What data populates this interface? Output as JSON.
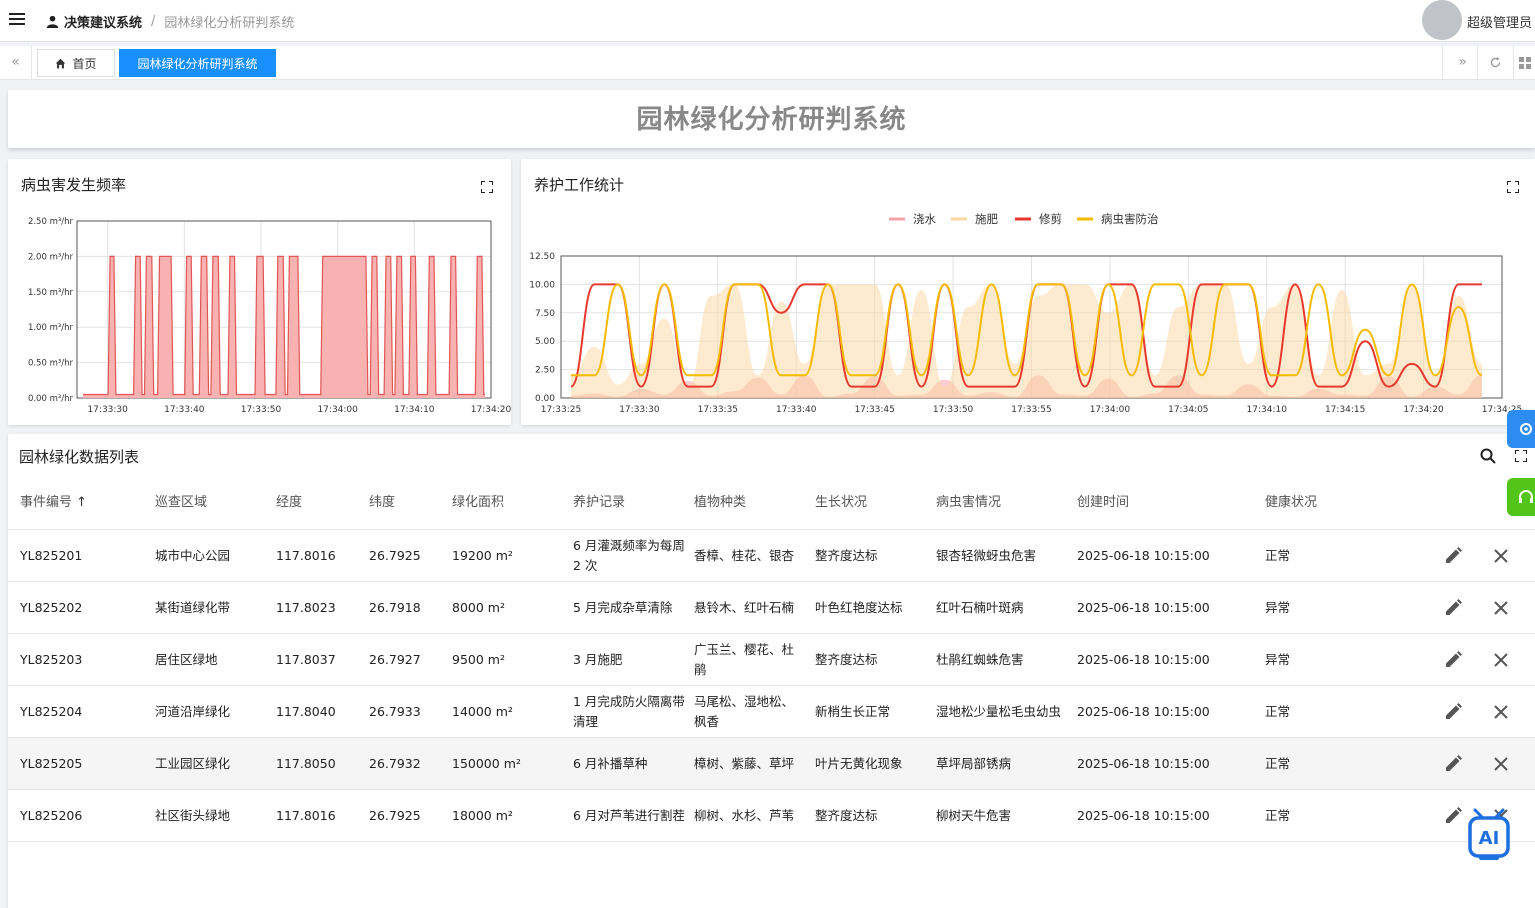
{
  "topbar": {
    "breadcrumb_root": "决策建议系统",
    "breadcrumb_separator": "/",
    "breadcrumb_current": "园林绿化分析研判系统",
    "username": "超级管理员"
  },
  "tabs": {
    "home": "首页",
    "active": "园林绿化分析研判系统"
  },
  "page": {
    "title": "园林绿化分析研判系统"
  },
  "colors": {
    "accent": "#1890ff",
    "chart1_fill": "#f8b2b2",
    "chart1_line": "#e05555",
    "water": "#f4a3a8",
    "fertilize": "#fdd6a0",
    "prune": "#e8392e",
    "pest": "#f6bb00",
    "side_blue": "#2d8cf0",
    "side_green": "#52c41a"
  },
  "chart_data": [
    {
      "type": "area",
      "title": "病虫害发生频率",
      "y_unit": "m³/hr",
      "yticks": [
        "2.50 m³/hr",
        "2.00 m³/hr",
        "1.50 m³/hr",
        "1.00 m³/hr",
        "0.50 m³/hr",
        "0.00 m³/hr"
      ],
      "ylim": [
        0,
        2.5
      ],
      "xticks": [
        "17:33:30",
        "17:33:40",
        "17:33:50",
        "17:34:00",
        "17:34:10",
        "17:34:20"
      ],
      "xlim_seconds": [
        26,
        50
      ],
      "grid": true,
      "pulses": [
        {
          "start_s": 30.5,
          "end_s": 31.0
        },
        {
          "start_s": 33.8,
          "end_s": 34.4
        },
        {
          "start_s": 35.2,
          "end_s": 35.9
        },
        {
          "start_s": 36.9,
          "end_s": 38.4
        },
        {
          "start_s": 40.4,
          "end_s": 41.0
        },
        {
          "start_s": 42.3,
          "end_s": 43.0
        },
        {
          "start_s": 43.8,
          "end_s": 44.5
        },
        {
          "start_s": 46.0,
          "end_s": 46.6
        },
        {
          "start_s": 49.5,
          "end_s": 50.3
        },
        {
          "start_s": 52.2,
          "end_s": 52.9
        },
        {
          "start_s": 53.7,
          "end_s": 54.8
        },
        {
          "start_s": 58.0,
          "end_s": 63.6
        },
        {
          "start_s": 64.4,
          "end_s": 65.0
        },
        {
          "start_s": 66.2,
          "end_s": 66.8
        },
        {
          "start_s": 67.6,
          "end_s": 68.2
        },
        {
          "start_s": 69.4,
          "end_s": 70.0
        },
        {
          "start_s": 71.8,
          "end_s": 72.4
        },
        {
          "start_s": 74.6,
          "end_s": 75.2
        },
        {
          "start_s": 78.0,
          "end_s": 78.6
        }
      ],
      "pulse_value": 2.0,
      "baseline_value": 0.05
    },
    {
      "type": "line",
      "title": "养护工作统计",
      "legend": [
        "浇水",
        "施肥",
        "修剪",
        "病虫害防治"
      ],
      "legend_position": "top-center",
      "yticks": [
        "12.50",
        "10.00",
        "7.50",
        "5.00",
        "2.50",
        "0.00"
      ],
      "ylim": [
        0,
        12.5
      ],
      "xticks": [
        "17:33:25",
        "17:33:30",
        "17:33:35",
        "17:33:40",
        "17:33:45",
        "17:33:50",
        "17:33:55",
        "17:34:00",
        "17:34:05",
        "17:34:10",
        "17:34:15",
        "17:34:20",
        "17:34:25"
      ],
      "grid": true,
      "series": [
        {
          "name": "浇水",
          "style": "area",
          "values": [
            0.2,
            0.4,
            0.1,
            0.8,
            0.3,
            1.5,
            0.2,
            0.6,
            1.8,
            0.3,
            2.0,
            0.1,
            0.4,
            1.9,
            0.2,
            0.3,
            1.6,
            0.2,
            0.5,
            0.1,
            2.0,
            0.3,
            0.2,
            1.7,
            0.1,
            0.4,
            2.0,
            0.3,
            0.2,
            1.2,
            0.2,
            0.1,
            0.8,
            0.3,
            0.2,
            1.9,
            0.1,
            1.0,
            0.3,
            2.0
          ]
        },
        {
          "name": "施肥",
          "style": "area",
          "values": [
            2.0,
            4.5,
            1.2,
            3.0,
            7.0,
            1.0,
            9.0,
            10.0,
            2.0,
            8.5,
            3.0,
            10.0,
            10.0,
            10.0,
            2.0,
            9.5,
            1.0,
            8.0,
            10.0,
            3.0,
            9.0,
            10.0,
            10.0,
            7.5,
            10.0,
            2.0,
            8.0,
            10.0,
            10.0,
            3.0,
            8.0,
            10.0,
            2.0,
            9.5,
            2.0,
            3.0,
            10.0,
            2.0,
            9.0,
            3.0
          ]
        },
        {
          "name": "修剪",
          "style": "line",
          "values": [
            1.0,
            10.0,
            10.0,
            1.0,
            10.0,
            1.0,
            1.0,
            10.0,
            10.0,
            7.5,
            10.0,
            10.0,
            1.0,
            1.0,
            10.0,
            1.0,
            10.0,
            1.0,
            1.0,
            1.0,
            10.0,
            10.0,
            1.0,
            10.0,
            10.0,
            1.0,
            1.0,
            10.0,
            10.0,
            10.0,
            1.0,
            10.0,
            1.0,
            1.0,
            5.0,
            1.0,
            3.0,
            1.0,
            10.0,
            10.0
          ]
        },
        {
          "name": "病虫害防治",
          "style": "line",
          "values": [
            2.0,
            2.0,
            10.0,
            2.0,
            10.0,
            2.0,
            2.0,
            10.0,
            10.0,
            2.0,
            2.0,
            10.0,
            2.0,
            2.0,
            10.0,
            2.0,
            10.0,
            2.0,
            10.0,
            2.0,
            10.0,
            10.0,
            2.0,
            10.0,
            2.0,
            10.0,
            10.0,
            2.0,
            10.0,
            10.0,
            2.0,
            2.0,
            10.0,
            2.0,
            6.0,
            2.0,
            10.0,
            2.0,
            8.0,
            2.0
          ]
        }
      ]
    }
  ],
  "table": {
    "title": "园林绿化数据列表",
    "columns": [
      "事件编号",
      "巡查区域",
      "经度",
      "纬度",
      "绿化面积",
      "养护记录",
      "植物种类",
      "生长状况",
      "病虫害情况",
      "创建时间",
      "健康状况"
    ],
    "rows": [
      [
        "YL825201",
        "城市中心公园",
        "117.8016",
        "26.7925",
        "19200 m²",
        "6 月灌溉频率为每周 2 次",
        "香樟、桂花、银杏",
        "整齐度达标",
        "银杏轻微蚜虫危害",
        "2025-06-18 10:15:00",
        "正常"
      ],
      [
        "YL825202",
        "某街道绿化带",
        "117.8023",
        "26.7918",
        "8000 m²",
        "5 月完成杂草清除",
        "悬铃木、红叶石楠",
        "叶色红艳度达标",
        "红叶石楠叶斑病",
        "2025-06-18 10:15:00",
        "异常"
      ],
      [
        "YL825203",
        "居住区绿地",
        "117.8037",
        "26.7927",
        "9500 m²",
        "3 月施肥",
        "广玉兰、樱花、杜鹃",
        "整齐度达标",
        "杜鹃红蜘蛛危害",
        "2025-06-18 10:15:00",
        "异常"
      ],
      [
        "YL825204",
        "河道沿岸绿化",
        "117.8040",
        "26.7933",
        "14000 m²",
        "1 月完成防火隔离带清理",
        "马尾松、湿地松、枫香",
        "新梢生长正常",
        "湿地松少量松毛虫幼虫",
        "2025-06-18 10:15:00",
        "正常"
      ],
      [
        "YL825205",
        "工业园区绿化",
        "117.8050",
        "26.7932",
        "150000 m²",
        "6 月补播草种",
        "樟树、紫藤、草坪",
        "叶片无黄化现象",
        "草坪局部锈病",
        "2025-06-18 10:15:00",
        "正常"
      ],
      [
        "YL825206",
        "社区街头绿地",
        "117.8016",
        "26.7925",
        "18000 m²",
        "6 月对芦苇进行割茬",
        "柳树、水杉、芦苇",
        "整齐度达标",
        "柳树天牛危害",
        "2025-06-18 10:15:00",
        "正常"
      ]
    ]
  },
  "icons": {
    "menu": "hamburger-icon",
    "user": "user-icon",
    "home": "home-icon",
    "refresh": "refresh-icon",
    "grid": "grid-icon",
    "search": "search-icon",
    "fullscreen": "fullscreen-icon",
    "edit": "pencil-icon",
    "delete": "close-icon",
    "settings": "gear-icon",
    "ai": "ai-robot-icon"
  }
}
